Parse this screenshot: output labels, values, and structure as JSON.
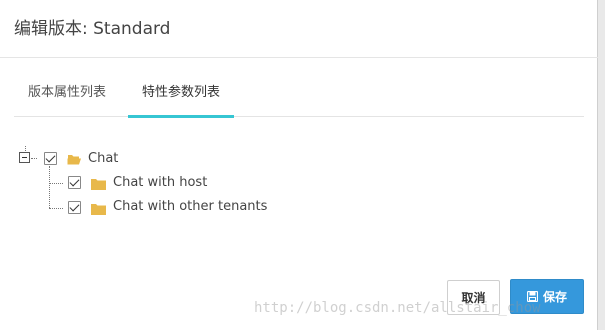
{
  "modal": {
    "title": "编辑版本: Standard"
  },
  "tabs": [
    {
      "label": "版本属性列表",
      "active": false
    },
    {
      "label": "特性参数列表",
      "active": true
    }
  ],
  "tree": {
    "root": {
      "label": "Chat",
      "checked": true,
      "expanded": true,
      "icon": "folder-open-icon"
    },
    "children": [
      {
        "label": "Chat with host",
        "checked": true,
        "icon": "folder-icon"
      },
      {
        "label": "Chat with other tenants",
        "checked": true,
        "icon": "folder-icon"
      }
    ]
  },
  "footer": {
    "cancel_label": "取消",
    "save_label": "保存"
  },
  "watermark": "http://blog.csdn.net/allstair_chow",
  "colors": {
    "accent": "#36c6d3",
    "primary_button": "#3598dc",
    "folder": "#e8b84a"
  }
}
